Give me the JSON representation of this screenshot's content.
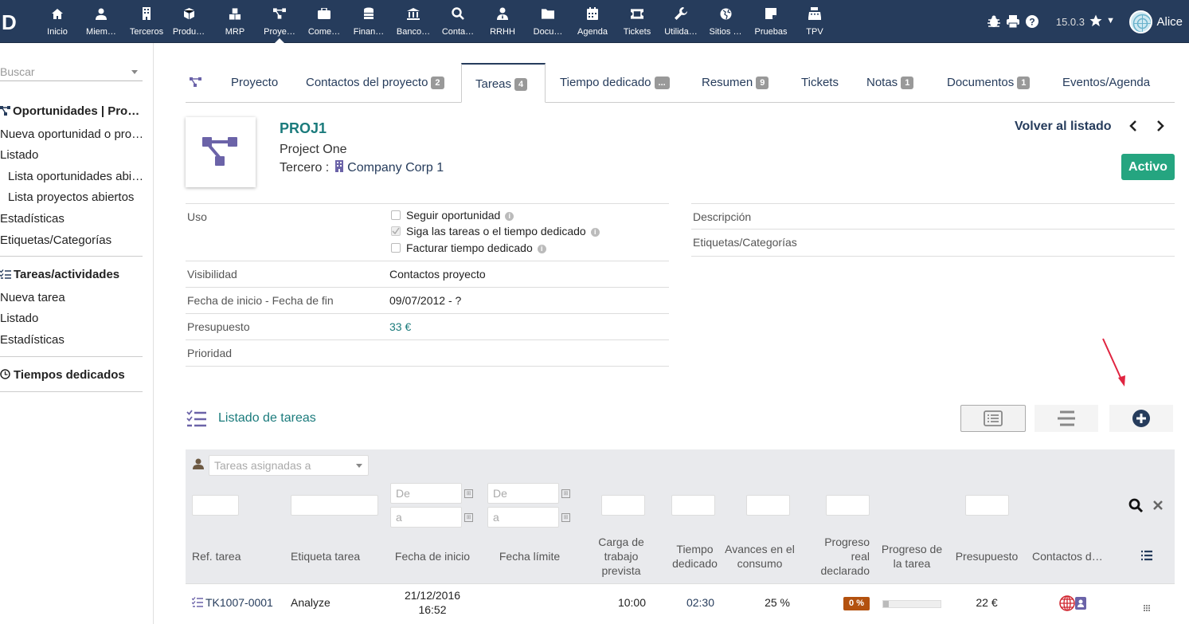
{
  "topbar": {
    "menu": [
      {
        "label": "Inicio",
        "icon": "home-icon"
      },
      {
        "label": "Miem…",
        "icon": "user-icon"
      },
      {
        "label": "Terceros",
        "icon": "building-icon"
      },
      {
        "label": "Produ…",
        "icon": "cube-icon"
      },
      {
        "label": "MRP",
        "icon": "cubes-icon"
      },
      {
        "label": "Proye…",
        "icon": "project-icon"
      },
      {
        "label": "Come…",
        "icon": "briefcase-icon"
      },
      {
        "label": "Finan…",
        "icon": "coins-icon"
      },
      {
        "label": "Banco…",
        "icon": "bank-icon"
      },
      {
        "label": "Conta…",
        "icon": "search-dollar-icon"
      },
      {
        "label": "RRHH",
        "icon": "user-tie-icon"
      },
      {
        "label": "Docu…",
        "icon": "folder-icon"
      },
      {
        "label": "Agenda",
        "icon": "calendar-icon"
      },
      {
        "label": "Tickets",
        "icon": "ticket-icon"
      },
      {
        "label": "Utilida…",
        "icon": "wrench-icon"
      },
      {
        "label": "Sitios …",
        "icon": "globe-icon"
      },
      {
        "label": "Pruebas",
        "icon": "sticky-note-icon"
      },
      {
        "label": "TPV",
        "icon": "cash-register-icon"
      }
    ],
    "version": "15.0.3",
    "user": "Alice"
  },
  "left": {
    "search_placeholder": "Buscar",
    "sections": {
      "opp_title": "Oportunidades | Pro…",
      "opp_new": "Nueva oportunidad o pro…",
      "opp_list": "Listado",
      "opp_open_opp": "Lista oportunidades abi…",
      "opp_open_proj": "Lista proyectos abiertos",
      "opp_stats": "Estadísticas",
      "opp_tags": "Etiquetas/Categorías",
      "task_title": "Tareas/actividades",
      "task_new": "Nueva tarea",
      "task_list": "Listado",
      "task_stats": "Estadísticas",
      "time_title": "Tiempos dedicados"
    }
  },
  "tabs": [
    {
      "label": "Proyecto",
      "badge": null
    },
    {
      "label": "Contactos del proyecto",
      "badge": "2"
    },
    {
      "label": "Tareas",
      "badge": "4"
    },
    {
      "label": "Tiempo dedicado",
      "badge": "..."
    },
    {
      "label": "Resumen",
      "badge": "9"
    },
    {
      "label": "Tickets",
      "badge": null
    },
    {
      "label": "Notas",
      "badge": "1"
    },
    {
      "label": "Documentos",
      "badge": "1"
    },
    {
      "label": "Eventos/Agenda",
      "badge": null
    }
  ],
  "project": {
    "ref": "PROJ1",
    "label": "Project One",
    "thirdparty_label": "Tercero :",
    "thirdparty": "Company Corp 1",
    "back": "Volver al listado",
    "status": "Activo"
  },
  "fields": {
    "uso_label": "Uso",
    "uso_opt1": "Seguir oportunidad",
    "uso_opt2": "Siga las tareas o el tiempo dedicado",
    "uso_opt3": "Facturar tiempo dedicado",
    "visibility_label": "Visibilidad",
    "visibility": "Contactos proyecto",
    "dates_label": "Fecha de inicio - Fecha de fin",
    "dates": "09/07/2012 - ?",
    "budget_label": "Presupuesto",
    "budget": "33 €",
    "priority_label": "Prioridad",
    "desc_label": "Descripción",
    "tags_label": "Etiquetas/Categorías"
  },
  "tasklist": {
    "title": "Listado de tareas",
    "assigned_placeholder": "Tareas asignadas a",
    "from_placeholder": "De",
    "to_placeholder": "a",
    "headers": {
      "ref": "Ref. tarea",
      "label": "Etiqueta tarea",
      "start": "Fecha de inicio",
      "end": "Fecha límite",
      "planned": "Carga de trabajo prevista",
      "spent": "Tiempo dedicado",
      "progress_calc": "Avances en el consumo",
      "progress_declared": "Progreso real declarado",
      "progress_task": "Progreso de la tarea",
      "budget": "Presupuesto",
      "contacts": "Contactos d…"
    },
    "rows": [
      {
        "ref": "TK1007-0001",
        "label": "Analyze",
        "start_date": "21/12/2016",
        "start_time": "16:52",
        "planned": "10:00",
        "spent": "02:30",
        "progress_calc": "25 %",
        "progress_declared": "0 %",
        "progress_task_fraction": 0.1,
        "budget": "22 €"
      }
    ]
  },
  "colors": {
    "topbar": "#263c5c",
    "accent_green": "#25a580",
    "link": "#263c5c",
    "teal": "#1b7b7c",
    "badge_orange": "#b3510e"
  }
}
